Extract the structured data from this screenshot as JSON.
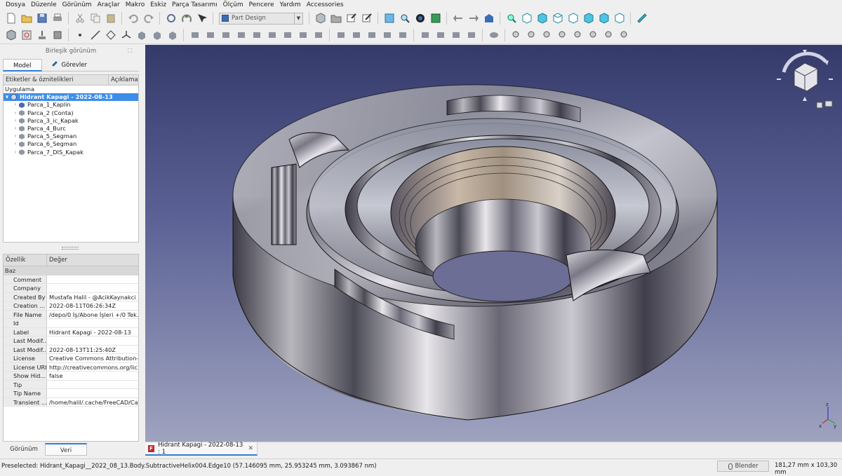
{
  "menubar": [
    "Dosya",
    "Düzenle",
    "Görünüm",
    "Araçlar",
    "Makro",
    "Eskiz",
    "Parça Tasarımı",
    "Ölçüm",
    "Pencere",
    "Yardım",
    "Accessories"
  ],
  "toolbar": {
    "workbench": "Part Design"
  },
  "combo": {
    "title": "Birleşik görünüm",
    "tab_model": "Model",
    "tab_tasks": "Görevler"
  },
  "tree": {
    "header_labels": "Etiketler & öznitelikleri",
    "header_desc": "Açıklama",
    "root": "Uygulama",
    "document": "Hidrant Kapagi - 2022-08-13",
    "items": [
      "Parca_1_Kaplin",
      "Parca_2 (Conta)",
      "Parca_3_ic_Kapak",
      "Parca_4_Burc",
      "Parca_5_Segman",
      "Parca_6_Segman",
      "Parca_7_DIS_Kapak"
    ]
  },
  "props": {
    "header_prop": "Özellik",
    "header_value": "Değer",
    "group": "Baz",
    "rows": [
      {
        "k": "Comment",
        "v": ""
      },
      {
        "k": "Company",
        "v": ""
      },
      {
        "k": "Created By",
        "v": "Mustafa Halil - @AcikKaynakci"
      },
      {
        "k": "Creation ...",
        "v": "2022-08-11T06:26:34Z"
      },
      {
        "k": "File Name",
        "v": "/depo/0 İş/Abone İşleri +/0 Tek..."
      },
      {
        "k": "Id",
        "v": ""
      },
      {
        "k": "Label",
        "v": "Hidrant Kapagi - 2022-08-13"
      },
      {
        "k": "Last Modif...",
        "v": ""
      },
      {
        "k": "Last Modif...",
        "v": "2022-08-13T11:25:40Z"
      },
      {
        "k": "License",
        "v": "Creative Commons Attribution-..."
      },
      {
        "k": "License URL",
        "v": "http://creativecommons.org/lic..."
      },
      {
        "k": "Show Hid...",
        "v": "false"
      },
      {
        "k": "Tip",
        "v": ""
      },
      {
        "k": "Tip Name",
        "v": ""
      },
      {
        "k": "Transient ...",
        "v": "/home/halil/.cache/FreeCAD/Ca..."
      }
    ]
  },
  "bottom_tabs": {
    "view": "Görünüm",
    "data": "Veri"
  },
  "doc_tab": {
    "label": "Hidrant Kapagi - 2022-08-13 : 1",
    "close": "✕"
  },
  "status": {
    "text": "Preselected: Hidrant_Kapagi__2022_08_13.Body.SubtractiveHelix004.Edge10 (57.146095 mm, 25.953245 mm, 3.093867 nm)",
    "nav_style": "Blender",
    "dimensions": "181,27 mm x 103,30 mm"
  }
}
